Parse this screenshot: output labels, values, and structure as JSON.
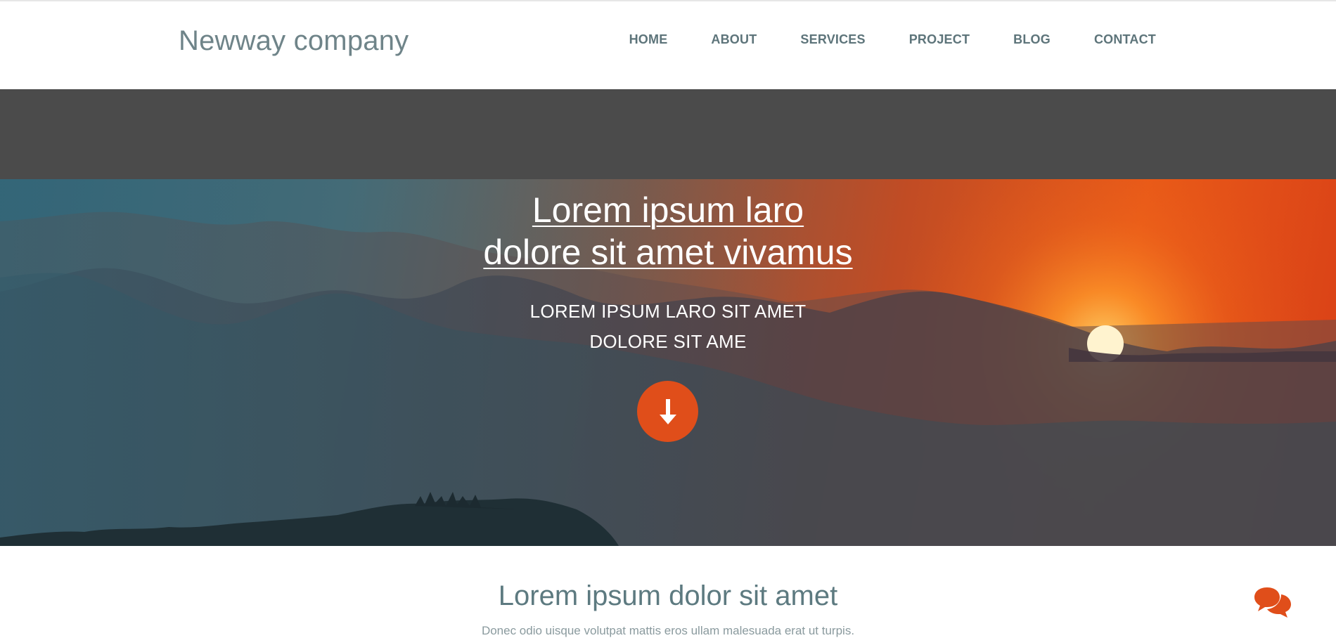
{
  "brand": {
    "name": "Newway company"
  },
  "nav": {
    "items": [
      {
        "label": "HOME"
      },
      {
        "label": "ABOUT"
      },
      {
        "label": "SERVICES"
      },
      {
        "label": "PROJECT"
      },
      {
        "label": "BLOG"
      },
      {
        "label": "CONTACT"
      }
    ]
  },
  "hero": {
    "title_line1": "Lorem ipsum laro",
    "title_line2": "dolore sit amet vivamus",
    "subtitle_line1": "LOREM IPSUM LARO SIT AMET",
    "subtitle_line2": "DOLORE SIT AME",
    "scroll_icon": "arrow-down-icon",
    "accent_color": "#e04e1a"
  },
  "section": {
    "title": "Lorem ipsum dolor sit amet",
    "text": "Donec odio uisque volutpat mattis eros ullam malesuada erat ut turpis."
  },
  "chat": {
    "icon": "chat-bubbles-icon"
  },
  "colors": {
    "nav_text": "#5d747a",
    "grey_band": "#4b4b4b",
    "accent": "#e04e1a"
  }
}
